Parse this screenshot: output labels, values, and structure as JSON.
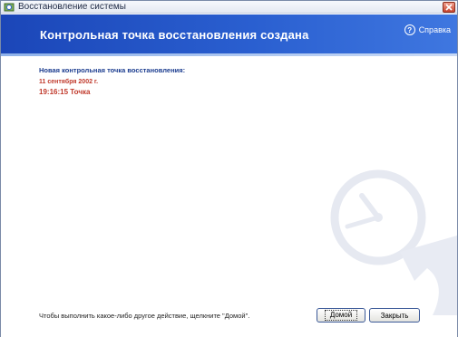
{
  "window": {
    "title": "Восстановление системы"
  },
  "banner": {
    "title": "Контрольная точка восстановления создана",
    "help_label": "Справка"
  },
  "content": {
    "heading": "Новая контрольная точка восстановления:",
    "date": "11 сентября 2002 г.",
    "point": "19:16:15 Точка"
  },
  "footer": {
    "hint": "Чтобы выполнить какое-либо другое действие, щелкните \"Домой\".",
    "home_label": "Домой",
    "close_label": "Закрыть"
  },
  "colors": {
    "banner": "#2a5fd0",
    "heading": "#1b3c8f",
    "accent_red": "#c0392b"
  },
  "icons": [
    "system-restore-icon",
    "close-icon",
    "help-icon",
    "clock-watermark-icon"
  ]
}
